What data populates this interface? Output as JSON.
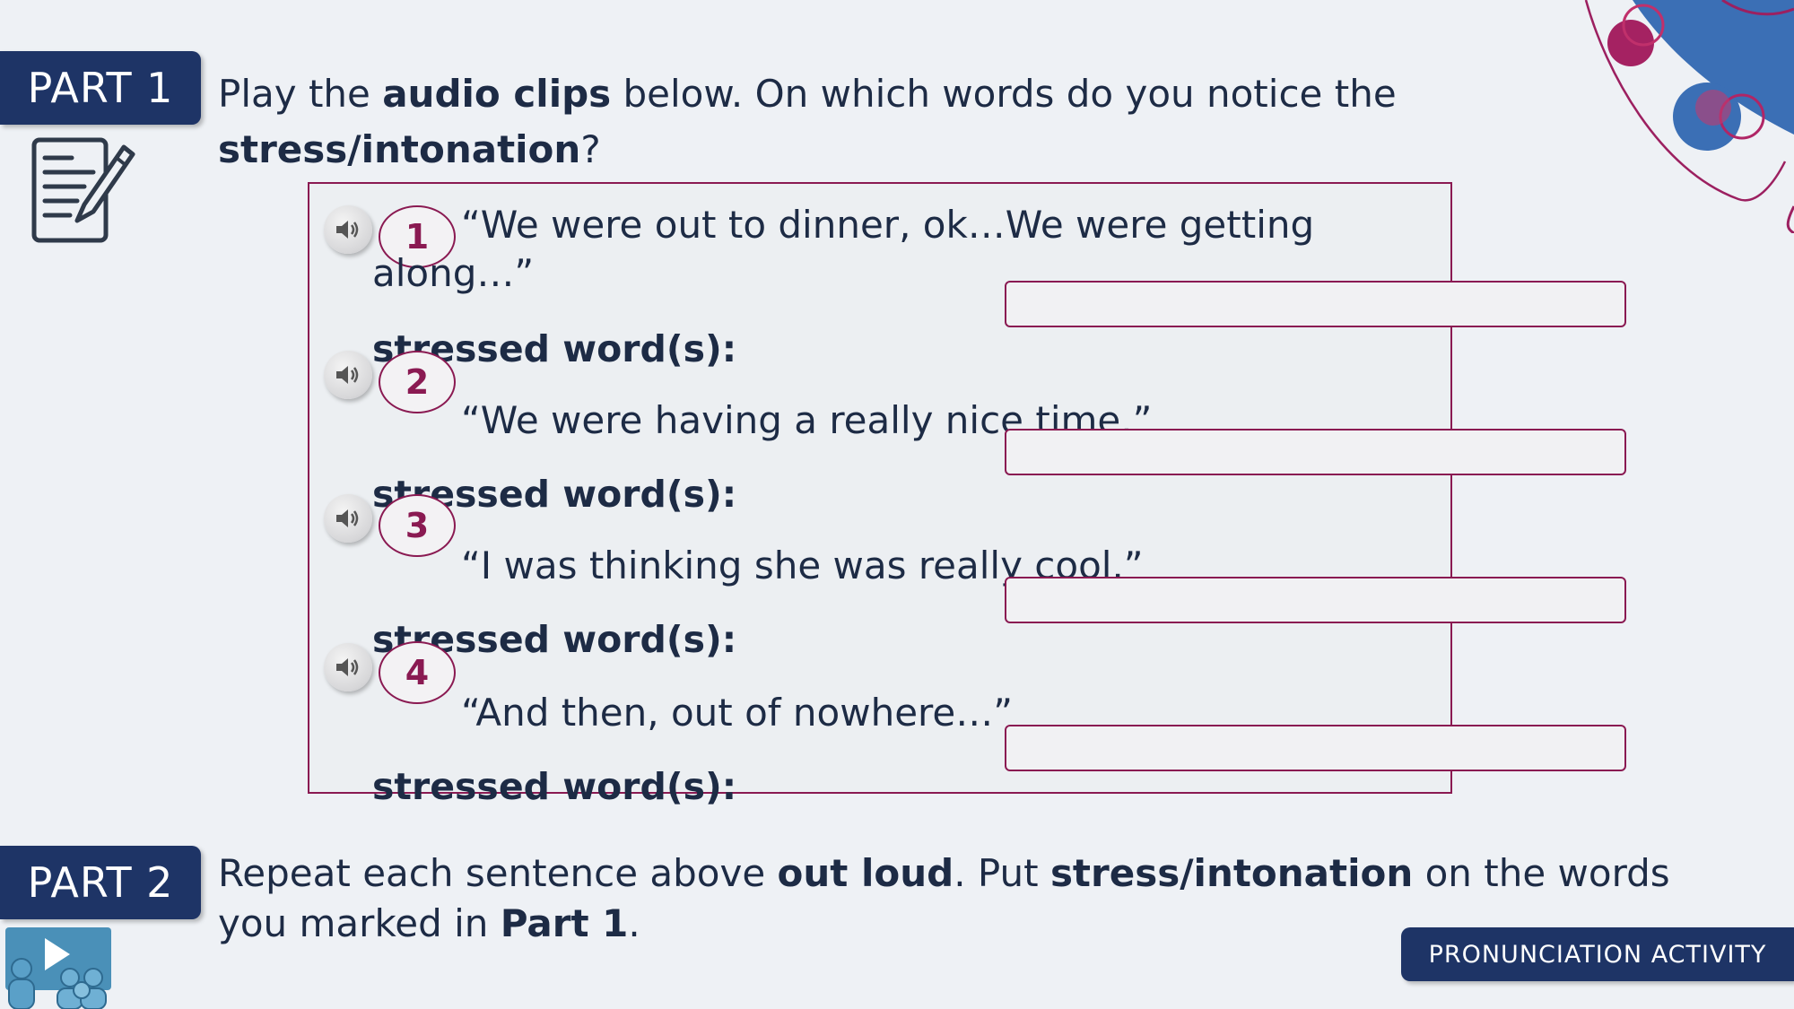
{
  "part1": {
    "badge": "PART 1",
    "line1_a": "Play the ",
    "line1_b": "audio clips",
    "line1_c": " below. On which words do you notice the",
    "line2_a": "stress/intonation",
    "line2_b": "?"
  },
  "clips": [
    {
      "number": "1",
      "quote_line1": "“We were out to dinner, ok…We were getting",
      "quote_line2": "along…”",
      "label": "stressed word(s):",
      "value": ""
    },
    {
      "number": "2",
      "quote_line1": "“We were having a really nice time.”",
      "label": "stressed word(s):",
      "value": ""
    },
    {
      "number": "3",
      "quote_line1": "“I was thinking she was really cool.”",
      "label": "stressed word(s):",
      "value": ""
    },
    {
      "number": "4",
      "quote_line1": "“And then, out of nowhere…”",
      "label": "stressed word(s):",
      "value": ""
    }
  ],
  "part2": {
    "badge": "PART 2",
    "text_a": "Repeat each sentence above ",
    "text_b": "out loud",
    "text_c": ". Put ",
    "text_d": "stress/intonation",
    "text_e": " on the words",
    "text_f": "you marked in ",
    "text_g": "Part 1",
    "text_h": "."
  },
  "footer": {
    "label": "PRONUNCIATION ACTIVITY"
  },
  "colors": {
    "navy": "#1e3466",
    "accent": "#8a1a52",
    "blue_decor": "#3b6fb5"
  },
  "icons": [
    "speaker-icon",
    "notepad-pencil-icon",
    "presentation-group-icon"
  ]
}
